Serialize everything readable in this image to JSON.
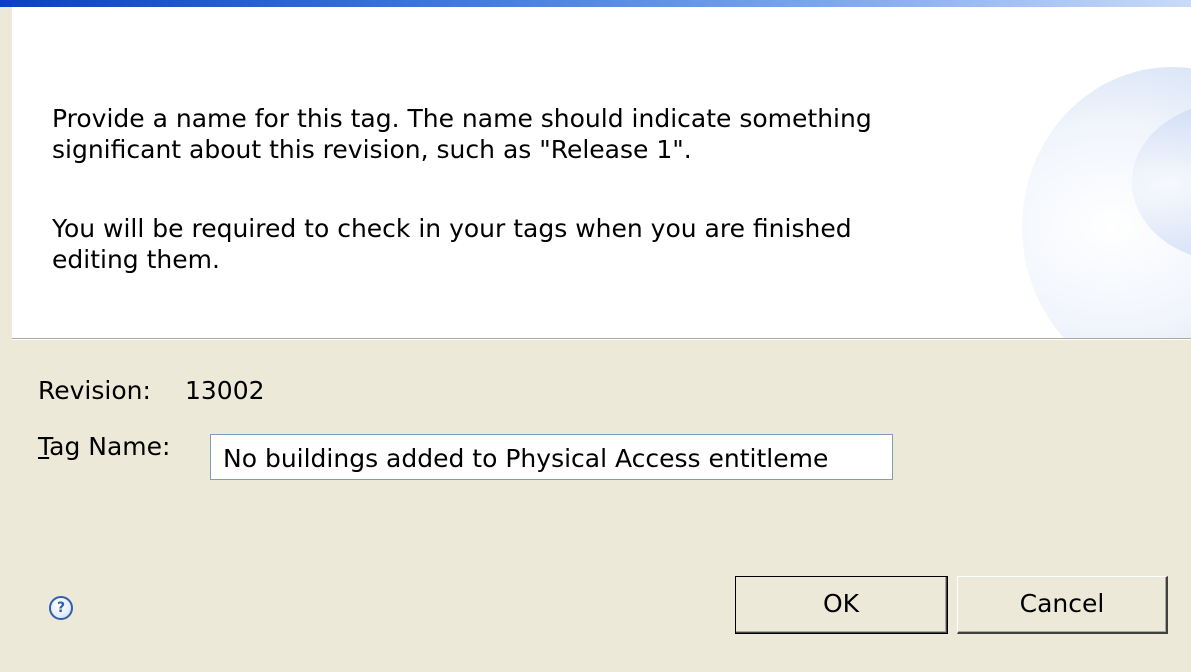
{
  "banner": {
    "message_1": "Provide a name for this tag.  The name should indicate something\nsignificant about this revision, such as \"Release 1\".",
    "message_2": "You will be required to check in your tags when you are finished\nediting them."
  },
  "form": {
    "revision_label": "Revision:",
    "revision_value": "13002",
    "tag_name_mnemonic": "T",
    "tag_name_label_rest": "ag Name:",
    "tag_name_value": "No buildings added to Physical Access entitleme"
  },
  "footer": {
    "help_icon": "help-icon",
    "help_glyph": "?",
    "ok_label": "OK",
    "cancel_label": "Cancel"
  },
  "colors": {
    "dialog_bg": "#ece9d8",
    "banner_bg": "#ffffff",
    "accent": "#0a3fc4"
  }
}
